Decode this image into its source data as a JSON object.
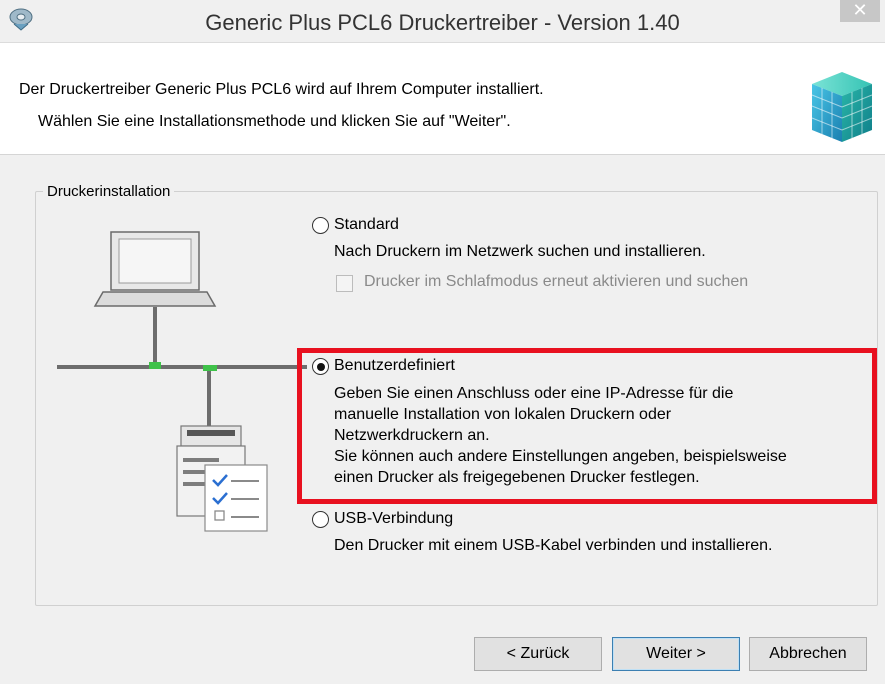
{
  "window": {
    "title": "Generic Plus PCL6 Druckertreiber - Version 1.40",
    "close_glyph": "✕"
  },
  "header": {
    "line1": "Der Druckertreiber Generic Plus PCL6 wird auf Ihrem Computer installiert.",
    "line2": "Wählen Sie eine Installationsmethode und klicken Sie auf \"Weiter\"."
  },
  "group": {
    "title": "Druckerinstallation",
    "options": [
      {
        "label": "Standard",
        "selected": false,
        "description": [
          "Nach Druckern im Netzwerk suchen und installieren."
        ],
        "checkbox": {
          "label": "Drucker im Schlafmodus erneut aktivieren und suchen",
          "checked": false,
          "enabled": false
        }
      },
      {
        "label": "Benutzerdefiniert",
        "selected": true,
        "description": [
          "Geben Sie einen Anschluss oder eine IP-Adresse für die",
          "manuelle Installation von lokalen Druckern oder",
          "Netzwerkdruckern an.",
          "Sie können auch andere Einstellungen angeben, beispielsweise",
          "einen Drucker als freigegebenen Drucker festlegen."
        ]
      },
      {
        "label": "USB-Verbindung",
        "selected": false,
        "description": [
          "Den Drucker mit einem USB-Kabel verbinden und installieren."
        ]
      }
    ]
  },
  "buttons": {
    "back": "< Zurück",
    "next": "Weiter >",
    "cancel": "Abbrechen"
  },
  "colors": {
    "highlight": "#e8101f",
    "network_connector": "#3fc24a"
  },
  "icons": [
    "setup-disc-icon",
    "blocks-cube-icon",
    "laptop-icon",
    "printer-icon",
    "checklist-icon"
  ]
}
